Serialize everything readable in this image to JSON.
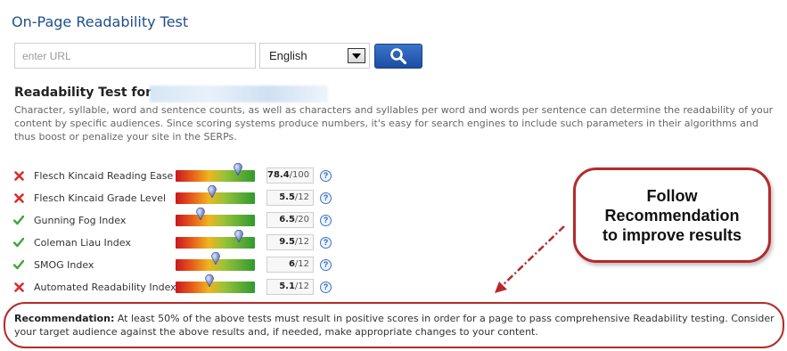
{
  "header": {
    "title": "On-Page Readability Test"
  },
  "search": {
    "placeholder": "enter URL",
    "language": "English"
  },
  "colors": {
    "title_blue": "#1f4e8c",
    "button_blue": "#1b4ea3",
    "fail_red": "#d92b2b",
    "pass_green": "#3fa535",
    "callout_red": "#b62a2a"
  },
  "result": {
    "title": "Readability Test for",
    "description": "Character, syllable, word and sentence counts, as well as characters and syllables per word and words per sentence can determine the readability of your content by specific audiences. Since scoring systems produce numbers, it's easy for search engines to include such parameters in their algorithms and thus boost or penalize your site in the SERPs."
  },
  "metrics": [
    {
      "name": "Flesch Kincaid Reading Ease",
      "status": "fail",
      "status_icon": "x-icon",
      "score": "78.4",
      "max": "/100",
      "gauge_level": 0.79
    },
    {
      "name": "Flesch Kincaid Grade Level",
      "status": "fail",
      "status_icon": "x-icon",
      "score": "5.5",
      "max": "/12",
      "gauge_level": 0.46
    },
    {
      "name": "Gunning Fog Index",
      "status": "pass",
      "status_icon": "check-icon",
      "score": "6.5",
      "max": "/20",
      "gauge_level": 0.32
    },
    {
      "name": "Coleman Liau Index",
      "status": "pass",
      "status_icon": "check-icon",
      "score": "9.5",
      "max": "/12",
      "gauge_level": 0.8
    },
    {
      "name": "SMOG Index",
      "status": "pass",
      "status_icon": "check-icon",
      "score": "6",
      "max": "/12",
      "gauge_level": 0.5
    },
    {
      "name": "Automated Readability Index",
      "status": "fail",
      "status_icon": "x-icon",
      "score": "5.1",
      "max": "/12",
      "gauge_level": 0.43
    }
  ],
  "help_icon": "?",
  "callout": {
    "text": "Follow\nRecommendation\nto improve results"
  },
  "recommendation": {
    "label": "Recommendation:",
    "text": "At least 50% of the above tests must result in positive scores in order for a page to pass comprehensive Readability testing. Consider your target audience against the above results and, if needed, make appropriate changes to your content."
  }
}
